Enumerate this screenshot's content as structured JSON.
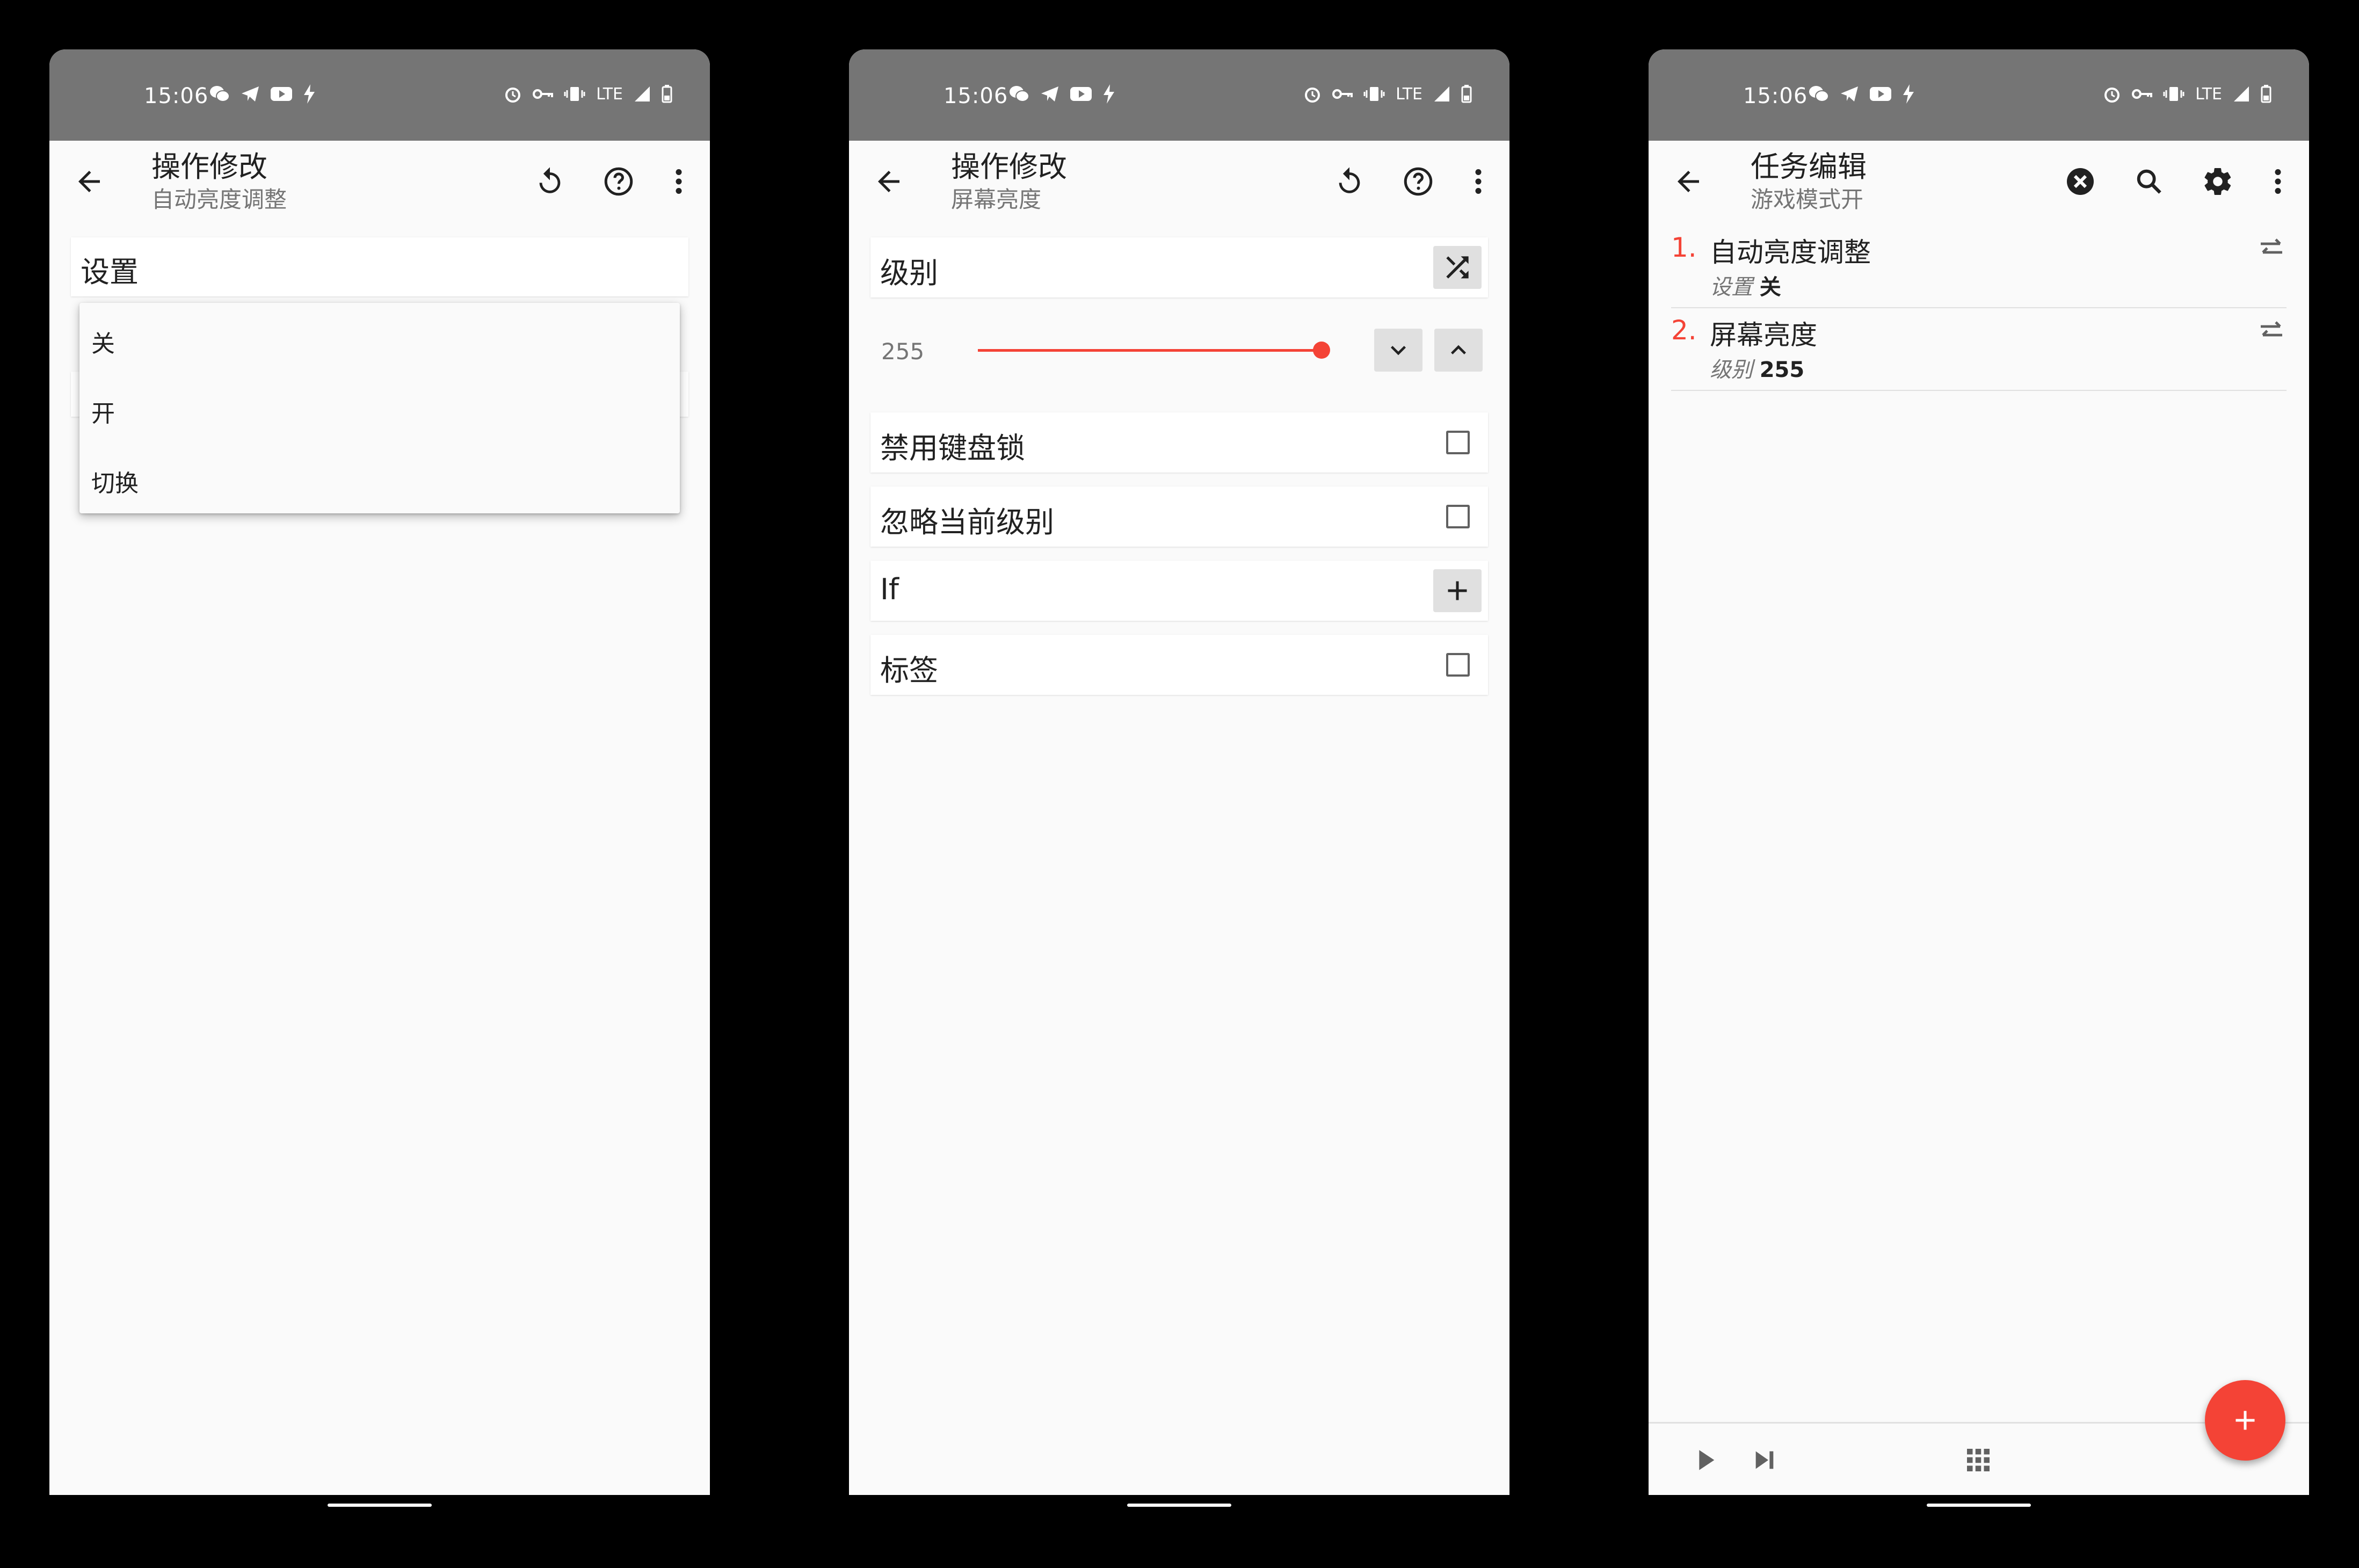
{
  "status": {
    "time": "15:06",
    "network": "LTE"
  },
  "screen1": {
    "title": "操作修改",
    "subtitle": "自动亮度调整",
    "field_label": "设置",
    "menu_items": [
      "关",
      "开",
      "切换"
    ]
  },
  "screen2": {
    "title": "操作修改",
    "subtitle": "屏幕亮度",
    "level_label": "级别",
    "level_value": "255",
    "slider_fraction": 1.0,
    "rows": [
      "禁用键盘锁",
      "忽略当前级别",
      "If",
      "标签"
    ]
  },
  "screen3": {
    "title": "任务编辑",
    "subtitle": "游戏模式开",
    "tasks": [
      {
        "num": "1.",
        "name": "自动亮度调整",
        "key": "设置",
        "value": "关"
      },
      {
        "num": "2.",
        "name": "屏幕亮度",
        "key": "级别",
        "value": "255"
      }
    ]
  },
  "colors": {
    "accent": "#f44336",
    "statusbar": "#757575",
    "background": "#fafafa"
  },
  "icons": [
    "back-arrow-icon",
    "undo-icon",
    "help-icon",
    "more-vert-icon",
    "shuffle-icon",
    "chevron-down-icon",
    "chevron-up-icon",
    "plus-icon",
    "close-circle-icon",
    "search-icon",
    "gear-icon",
    "swap-icon",
    "play-icon",
    "skip-next-icon",
    "grid-icon"
  ]
}
